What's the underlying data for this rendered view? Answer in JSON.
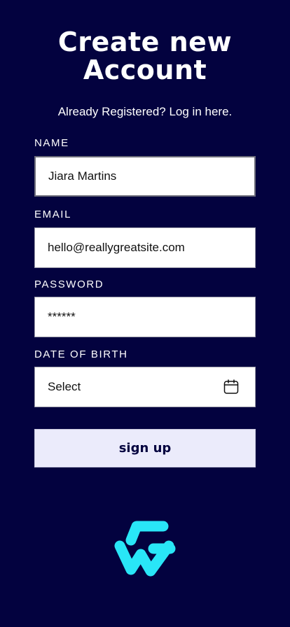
{
  "header": {
    "title_line1": "Create new",
    "title_line2": "Account",
    "subtitle": "Already Registered? Log in here."
  },
  "form": {
    "name": {
      "label": "NAME",
      "value": "Jiara Martins"
    },
    "email": {
      "label": "EMAIL",
      "value": "hello@reallygreatsite.com"
    },
    "password": {
      "label": "PASSWORD",
      "value": "******"
    },
    "dob": {
      "label": "DATE OF BIRTH",
      "value": "Select",
      "icon": "calendar-icon"
    },
    "submit_label": "sign up"
  },
  "logo": {
    "icon": "brand-logo",
    "color": "#29e6f7"
  },
  "colors": {
    "background": "#03023f",
    "field_bg": "#ffffff",
    "button_bg": "#ebebfb",
    "button_text": "#03023f"
  }
}
